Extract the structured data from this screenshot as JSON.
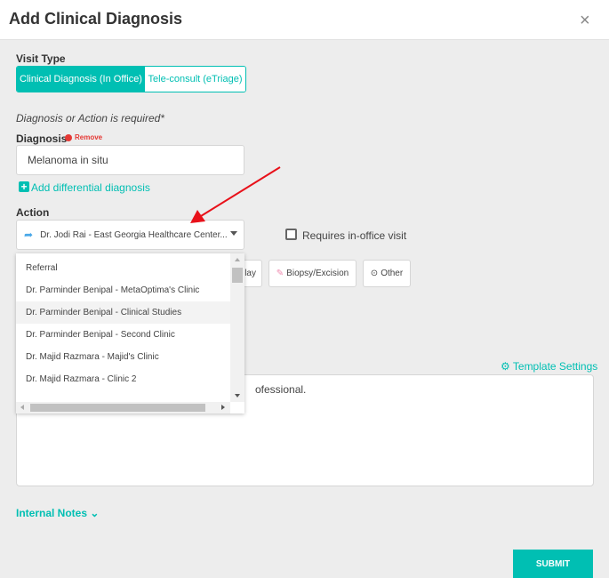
{
  "dialog": {
    "title": "Add Clinical Diagnosis",
    "close_icon": "×"
  },
  "visit_type": {
    "label": "Visit Type",
    "options": [
      "Clinical Diagnosis (In Office)",
      "Tele-consult (eTriage)"
    ],
    "selected": "Clinical Diagnosis (In Office)"
  },
  "required_note": "Diagnosis or Action is required*",
  "diagnosis": {
    "label": "Diagnosis",
    "remove_label": "Remove",
    "value": "Melanoma in situ",
    "add_differential": "Add differential diagnosis"
  },
  "action": {
    "label": "Action",
    "selected": "Dr. Jodi Rai - East Georgia Healthcare Center...",
    "requires_visit_label": "Requires in-office visit",
    "requires_visit_checked": false,
    "options": [
      "Referral",
      "Dr. Parminder Benipal - MetaOptima's Clinic",
      "Dr. Parminder Benipal - Clinical Studies",
      "Dr. Parminder Benipal - Second Clinic",
      "Dr. Majid Razmara - Majid's Clinic",
      "Dr. Majid Razmara - Clinic 2"
    ],
    "highlighted": "Dr. Parminder Benipal - Clinical Studies",
    "buttons": [
      "lay",
      "Biopsy/Excision",
      "Other"
    ]
  },
  "notes": {
    "template_settings": "Template Settings",
    "text_fragment": "ofessional."
  },
  "internal_notes": "Internal Notes",
  "submit": "SUBMIT",
  "colors": {
    "accent": "#00bfb3",
    "remove": "#e53935",
    "arrow": "#e8111a"
  }
}
